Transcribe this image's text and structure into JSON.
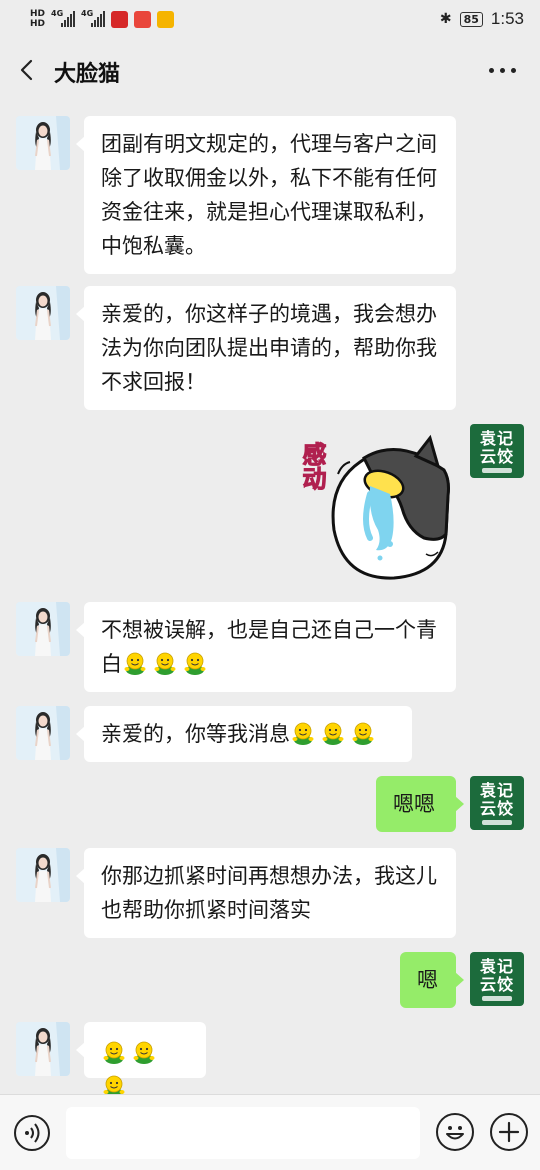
{
  "status_bar": {
    "hd1": "HD",
    "hd2": "HD",
    "net1": "4G",
    "net2": "4G",
    "battery": "85",
    "time": "1:53"
  },
  "header": {
    "title": "大脸猫"
  },
  "messages": [
    {
      "side": "left",
      "text": "团副有明文规定的，代理与客户之间除了收取佣金以外，私下不能有任何资金往来，就是担心代理谋取私利，中饱私囊。"
    },
    {
      "side": "left",
      "text": "亲爱的，你这样子的境遇，我会想办法为你向团队提出申请的，帮助你我不求回报！"
    },
    {
      "side": "right",
      "type": "sticker",
      "text": "感动"
    },
    {
      "side": "left",
      "text": "不想被误解，也是自己还自己一个青白",
      "emoji_count": 3
    },
    {
      "side": "left",
      "text": "亲爱的，你等我消息",
      "emoji_count": 3
    },
    {
      "side": "right",
      "text": "嗯嗯"
    },
    {
      "side": "left",
      "text": "你那边抓紧时间再想想办法，我这儿也帮助你抓紧时间落实"
    },
    {
      "side": "right",
      "text": "嗯"
    },
    {
      "side": "left",
      "text": "",
      "emoji_count": 3
    }
  ],
  "my_avatar": {
    "line1": "袁记",
    "line2": "云饺"
  },
  "input_bar": {
    "value": ""
  },
  "colors": {
    "background": "#ededed",
    "my_bubble": "#95ec69",
    "their_bubble": "#ffffff",
    "brand_green": "#1c6b3c"
  },
  "icons": {
    "back": "chevron-left-icon",
    "more": "more-dots-icon",
    "voice": "voice-icon",
    "emoji": "emoji-icon",
    "plus": "plus-icon",
    "inline_emoji": "green-smiley-emoji"
  }
}
